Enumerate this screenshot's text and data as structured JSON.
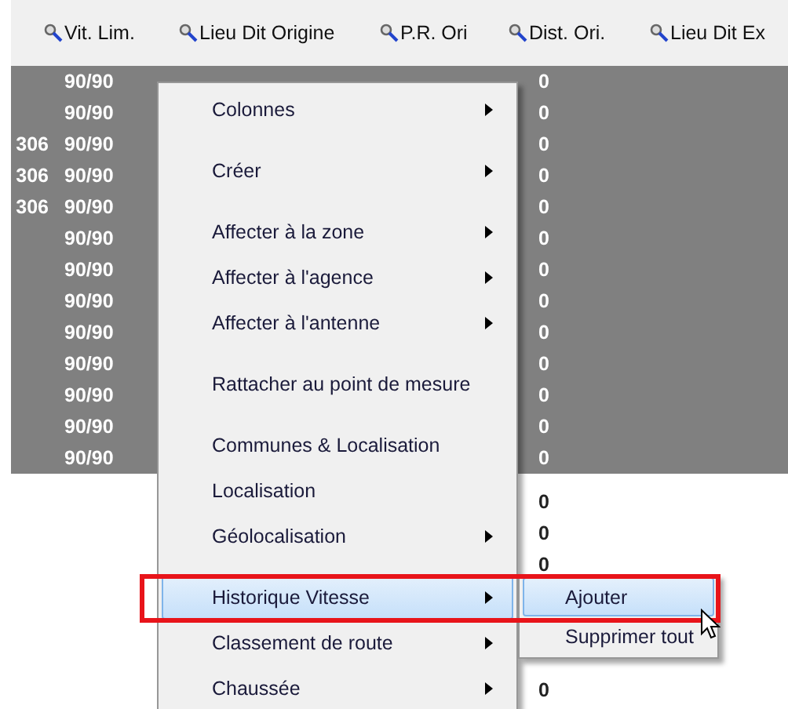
{
  "table": {
    "columns": [
      {
        "label": "Vit. Lim."
      },
      {
        "label": "Lieu Dit Origine"
      },
      {
        "label": "P.R. Ori"
      },
      {
        "label": "Dist. Ori."
      },
      {
        "label": "Lieu Dit Ex"
      }
    ],
    "rows": [
      {
        "selected": true,
        "vit_lim": "90/90",
        "dist_ori": "0"
      },
      {
        "selected": true,
        "vit_lim": "90/90",
        "dist_ori": "0"
      },
      {
        "selected": true,
        "column_1": "306",
        "vit_lim": "90/90",
        "dist_ori": "0"
      },
      {
        "selected": true,
        "column_1": "306",
        "vit_lim": "90/90",
        "dist_ori": "0"
      },
      {
        "selected": true,
        "column_1": "306",
        "vit_lim": "90/90",
        "dist_ori": "0"
      },
      {
        "selected": true,
        "vit_lim": "90/90",
        "dist_ori": "0"
      },
      {
        "selected": true,
        "vit_lim": "90/90",
        "dist_ori": "0"
      },
      {
        "selected": true,
        "vit_lim": "90/90",
        "dist_ori": "0"
      },
      {
        "selected": true,
        "vit_lim": "90/90",
        "dist_ori": "0"
      },
      {
        "selected": true,
        "vit_lim": "90/90",
        "dist_ori": "0"
      },
      {
        "selected": true,
        "vit_lim": "90/90",
        "dist_ori": "0"
      },
      {
        "selected": true,
        "vit_lim": "90/90",
        "dist_ori": "0"
      },
      {
        "selected": true,
        "vit_lim": "90/90",
        "dist_ori": "0"
      },
      {
        "selected": false,
        "dist_ori": "0"
      },
      {
        "selected": false,
        "dist_ori": "0"
      },
      {
        "selected": false,
        "dist_ori": "0"
      },
      {
        "selected": false,
        "dist_ori": "0"
      }
    ]
  },
  "context_menu": {
    "items": [
      {
        "kind": "item",
        "label": "Colonnes",
        "submenu": true,
        "selected": false
      },
      {
        "kind": "separator"
      },
      {
        "kind": "item",
        "label": "Créer",
        "submenu": true,
        "selected": false
      },
      {
        "kind": "separator"
      },
      {
        "kind": "item",
        "label": "Affecter à la zone",
        "submenu": true,
        "selected": false
      },
      {
        "kind": "item",
        "label": "Affecter à l'agence",
        "submenu": true,
        "selected": false
      },
      {
        "kind": "item",
        "label": "Affecter à l'antenne",
        "submenu": true,
        "selected": false
      },
      {
        "kind": "separator"
      },
      {
        "kind": "item",
        "label": "Rattacher au point de mesure",
        "submenu": false,
        "selected": false
      },
      {
        "kind": "separator"
      },
      {
        "kind": "item",
        "label": "Communes & Localisation",
        "submenu": false,
        "selected": false
      },
      {
        "kind": "item",
        "label": "Localisation",
        "submenu": false,
        "selected": false
      },
      {
        "kind": "item",
        "label": "Géolocalisation",
        "submenu": true,
        "selected": false
      },
      {
        "kind": "separator"
      },
      {
        "kind": "item",
        "label": "Historique Vitesse",
        "submenu": true,
        "selected": true
      },
      {
        "kind": "item",
        "label": "Classement de route",
        "submenu": true,
        "selected": false
      },
      {
        "kind": "item",
        "label": "Chaussée",
        "submenu": true,
        "selected": false
      }
    ]
  },
  "submenu": {
    "items": [
      {
        "label": "Ajouter",
        "selected": true
      },
      {
        "label": "Supprimer tout",
        "selected": false
      }
    ]
  }
}
